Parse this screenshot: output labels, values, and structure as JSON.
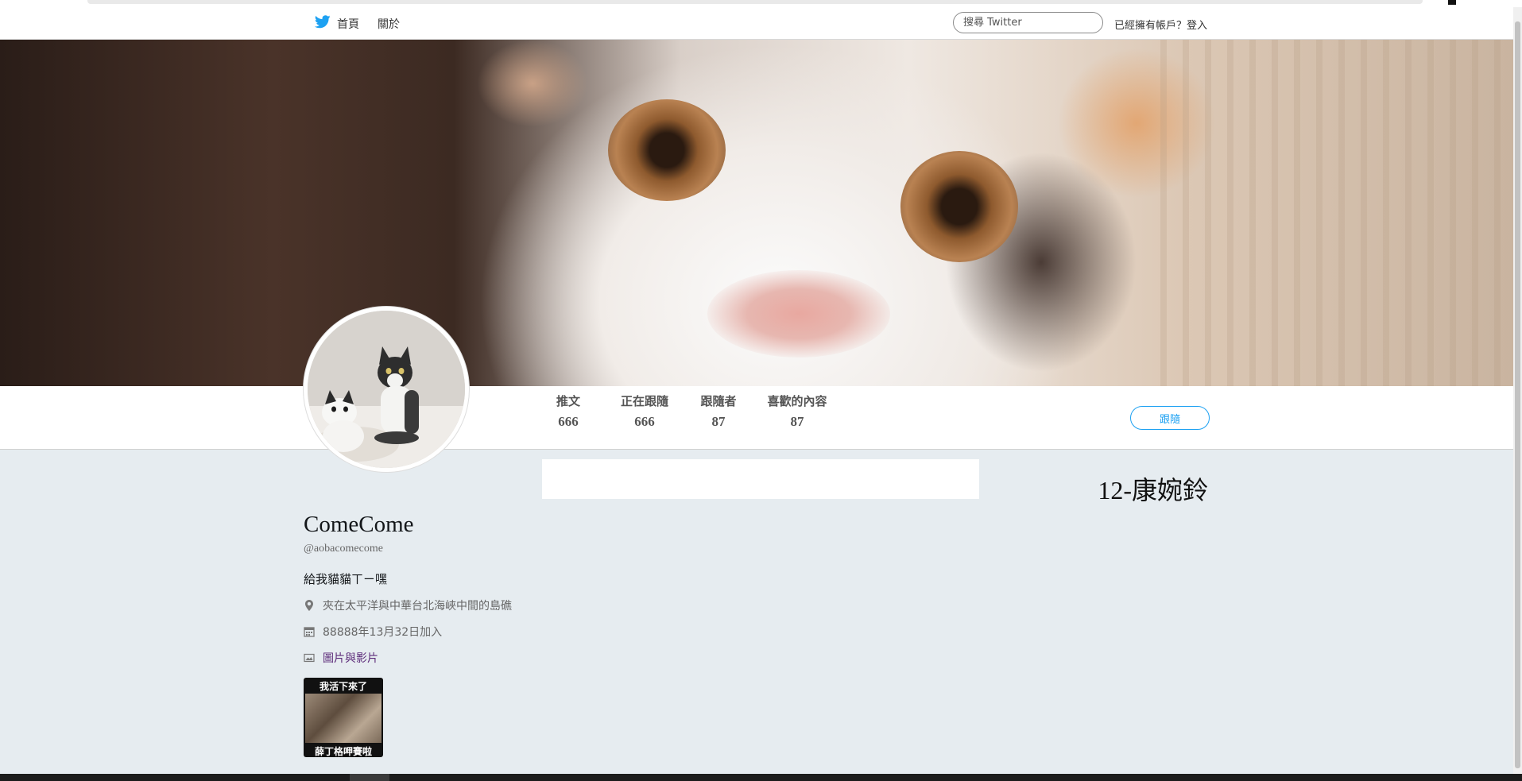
{
  "nav": {
    "home_label": "首頁",
    "about_label": "關於",
    "search_placeholder": "搜尋 Twitter",
    "login_prompt": "已經擁有帳戶？",
    "login_label": "登入",
    "brand_icon": "twitter-bird-icon",
    "brand_color": "#1da1f2"
  },
  "stats": [
    {
      "label": "推文",
      "value": "666"
    },
    {
      "label": "正在跟隨",
      "value": "666"
    },
    {
      "label": "跟隨者",
      "value": "87"
    },
    {
      "label": "喜歡的內容",
      "value": "87"
    }
  ],
  "follow_button": "跟隨",
  "side_title": "12-康婉鈴",
  "profile": {
    "name": "ComeCome",
    "handle": "@aobacomecome",
    "bio": "給我貓貓ㄒㄧ嘿",
    "location": "夾在太平洋與中華台北海峽中間的島礁",
    "joined": "88888年13月32日加入",
    "media_link": "圖片與影片"
  },
  "media_thumb": {
    "caption_top": "我活下來了",
    "caption_bottom": "薛丁格呷賽啦"
  }
}
